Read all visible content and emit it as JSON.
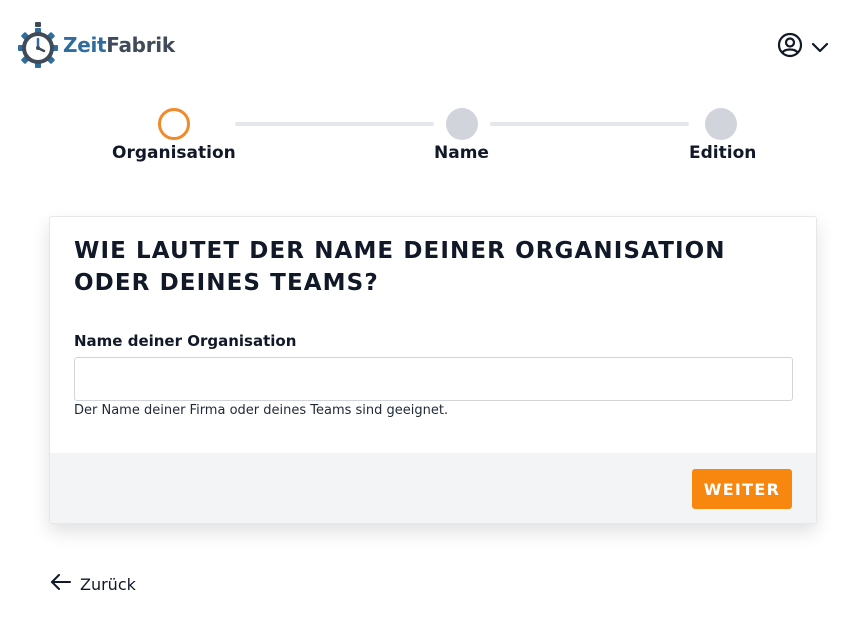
{
  "brand": {
    "logo_part1": "Zeit",
    "logo_part2": "Fabrik",
    "logo_icon": "stopwatch-gear-icon",
    "color_primary": "#2f6d9f",
    "color_secondary": "#3f4b58"
  },
  "header": {
    "user_icon": "user-circle-icon",
    "dropdown_icon": "chevron-down-icon"
  },
  "stepper": {
    "steps": [
      {
        "label": "Organisation",
        "state": "active"
      },
      {
        "label": "Name",
        "state": "inactive"
      },
      {
        "label": "Edition",
        "state": "inactive"
      }
    ],
    "active_color": "#f18a2a",
    "inactive_color": "#d1d5db"
  },
  "form": {
    "title": "WIE LAUTET DER NAME DEINER ORGANISATION ODER DEINES TEAMS?",
    "field_label": "Name deiner Organisation",
    "field_value": "",
    "field_placeholder": "",
    "field_help": "Der Name deiner Firma oder deines Teams sind geeignet.",
    "submit_label": "WEITER",
    "submit_color": "#f7870f"
  },
  "nav": {
    "back_label": "Zurück",
    "back_icon": "arrow-left-icon"
  }
}
